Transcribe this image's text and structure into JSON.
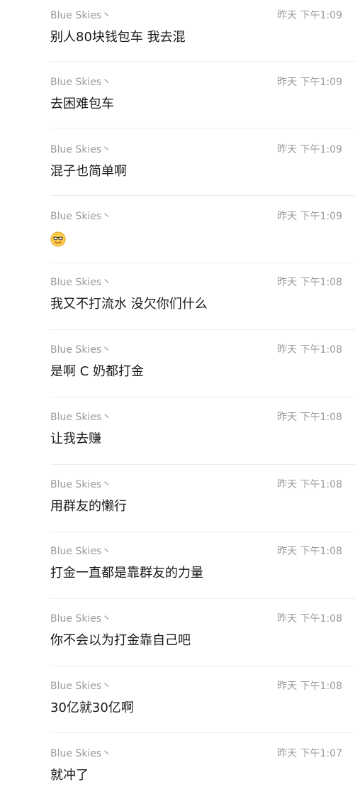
{
  "messages": [
    {
      "sender": "Blue Skies丶",
      "time": "昨天 下午1:09",
      "text": "别人80块钱包车 我去混"
    },
    {
      "sender": "Blue Skies丶",
      "time": "昨天 下午1:09",
      "text": "去困难包车"
    },
    {
      "sender": "Blue Skies丶",
      "time": "昨天 下午1:09",
      "text": "混子也简单啊"
    },
    {
      "sender": "Blue Skies丶",
      "time": "昨天 下午1:09",
      "emoji": "smiling-face-with-sunglasses"
    },
    {
      "sender": "Blue Skies丶",
      "time": "昨天 下午1:08",
      "text": "我又不打流水 没欠你们什么"
    },
    {
      "sender": "Blue Skies丶",
      "time": "昨天 下午1:08",
      "text": "是啊 C 奶都打金"
    },
    {
      "sender": "Blue Skies丶",
      "time": "昨天 下午1:08",
      "text": "让我去赚"
    },
    {
      "sender": "Blue Skies丶",
      "time": "昨天 下午1:08",
      "text": "用群友的懒行"
    },
    {
      "sender": "Blue Skies丶",
      "time": "昨天 下午1:08",
      "text": "打金一直都是靠群友的力量"
    },
    {
      "sender": "Blue Skies丶",
      "time": "昨天 下午1:08",
      "text": "你不会以为打金靠自己吧"
    },
    {
      "sender": "Blue Skies丶",
      "time": "昨天 下午1:08",
      "text": "30亿就30亿啊"
    },
    {
      "sender": "Blue Skies丶",
      "time": "昨天 下午1:07",
      "text": "就冲了"
    }
  ],
  "colors": {
    "meta": "#9a9a9a",
    "body": "#1a1a1a",
    "divider": "#eeeeee"
  }
}
